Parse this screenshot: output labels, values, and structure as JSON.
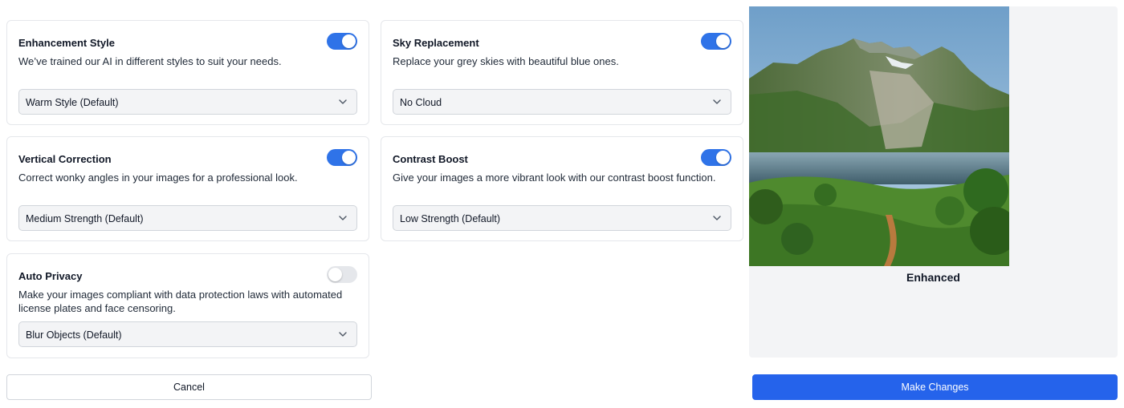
{
  "cards": [
    {
      "title": "Enhancement Style",
      "description": "We’ve trained our AI in different styles to suit your needs.",
      "enabled": true,
      "selected": "Warm Style (Default)"
    },
    {
      "title": "Sky Replacement",
      "description": "Replace your grey skies with beautiful blue ones.",
      "enabled": true,
      "selected": "No Cloud"
    },
    {
      "title": "Vertical Correction",
      "description": "Correct wonky angles in your images for a professional look.",
      "enabled": true,
      "selected": "Medium Strength (Default)"
    },
    {
      "title": "Contrast Boost",
      "description": "Give your images a more vibrant look with our contrast boost function.",
      "enabled": true,
      "selected": "Low Strength (Default)"
    },
    {
      "title": "Auto Privacy",
      "description": "Make your images compliant with data protection laws with automated license plates and face censoring.",
      "enabled": false,
      "selected": "Blur Objects (Default)"
    }
  ],
  "preview": {
    "caption": "Enhanced"
  },
  "actions": {
    "cancel_label": "Cancel",
    "submit_label": "Make Changes"
  },
  "colors": {
    "accent": "#2563eb",
    "toggle_on": "#2f73e8",
    "toggle_off": "#e5e7eb",
    "panel_bg": "#f3f4f6"
  },
  "icons": {
    "select": "chevron-down-icon"
  }
}
